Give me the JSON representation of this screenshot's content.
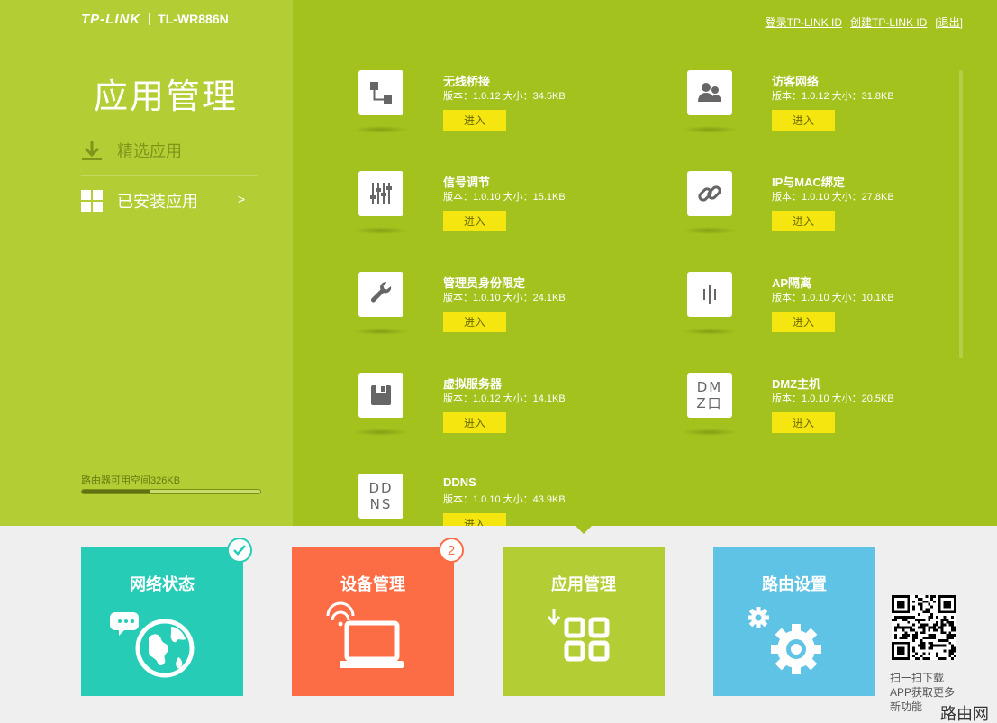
{
  "header": {
    "brand_logo": "TP-LINK",
    "model": "TL-WR886N",
    "links": [
      "登录TP-LINK ID",
      "创建TP-LINK ID",
      "[退出]"
    ]
  },
  "sidebar": {
    "title": "应用管理",
    "items": [
      {
        "label": "精选应用",
        "icon": "download-icon"
      },
      {
        "label": "已安装应用",
        "icon": "grid-icon",
        "arrow": ">"
      }
    ],
    "storage_label": "路由器可用空间326KB",
    "storage_used_fraction": 0.38
  },
  "apps": [
    {
      "name": "无线桥接",
      "meta": "版本：1.0.12 大小：34.5KB",
      "button": "进入",
      "icon": "bridge-icon"
    },
    {
      "name": "访客网络",
      "meta": "版本：1.0.12 大小：31.8KB",
      "button": "进入",
      "icon": "guest-users-icon"
    },
    {
      "name": "信号调节",
      "meta": "版本：1.0.10 大小：15.1KB",
      "button": "进入",
      "icon": "sliders-icon"
    },
    {
      "name": "IP与MAC绑定",
      "meta": "版本：1.0.10 大小：27.8KB",
      "button": "进入",
      "icon": "link-icon"
    },
    {
      "name": "管理员身份限定",
      "meta": "版本：1.0.10 大小：24.1KB",
      "button": "进入",
      "icon": "wrench-icon"
    },
    {
      "name": "AP隔离",
      "meta": "版本：1.0.10 大小：10.1KB",
      "button": "进入",
      "icon": "ap-isolation-icon"
    },
    {
      "name": "虚拟服务器",
      "meta": "版本：1.0.12 大小：14.1KB",
      "button": "进入",
      "icon": "server-icon"
    },
    {
      "name": "DMZ主机",
      "meta": "版本：1.0.10 大小：20.5KB",
      "button": "进入",
      "icon": "dmz-icon",
      "icon_text": [
        "DM",
        "Z口"
      ]
    },
    {
      "name": "DDNS",
      "meta": "版本：1.0.10 大小：43.9KB",
      "button": "进入",
      "icon": "ddns-icon",
      "icon_text": [
        "DD",
        "NS"
      ]
    }
  ],
  "tiles": [
    {
      "label": "网络状态",
      "color": "#27ccb7",
      "icon": "globe-icon"
    },
    {
      "label": "设备管理",
      "color": "#fc6d45",
      "icon": "laptop-icon",
      "badge": "2"
    },
    {
      "label": "应用管理",
      "color": "#b2ce34",
      "icon": "apps-grid-icon"
    },
    {
      "label": "路由设置",
      "color": "#5fc3e6",
      "icon": "gear-icon"
    }
  ],
  "qr": {
    "lines": [
      "扫一扫下载",
      "APP获取更多",
      "新功能"
    ]
  },
  "watermark": "路由网",
  "colors": {
    "accent_green": "#a3c21e",
    "sidebar_green": "#b2ce34",
    "button_yellow": "#f5e60f"
  }
}
